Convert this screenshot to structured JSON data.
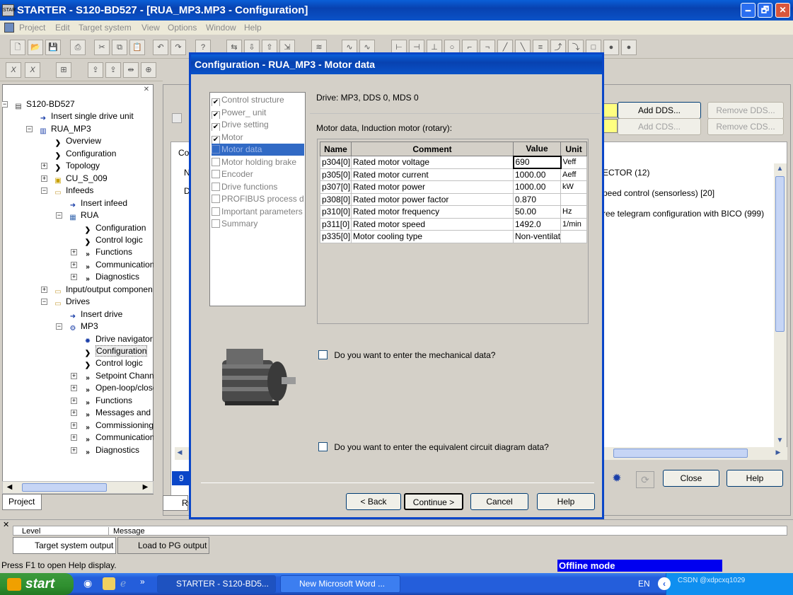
{
  "app": {
    "title": "STARTER - S120-BD527 - [RUA_MP3.MP3 - Configuration]",
    "icon_label": "STAR",
    "minimize": "🗕",
    "restore": "🗗",
    "close": "✕"
  },
  "menu": {
    "items": [
      "Project",
      "Edit",
      "Target system",
      "View",
      "Options",
      "Window",
      "Help"
    ]
  },
  "tree": {
    "items": [
      {
        "label": "S120-BD527",
        "icon": "project-icon"
      },
      {
        "label": "Insert single drive unit",
        "icon": "insert-icon"
      },
      {
        "label": "RUA_MP3",
        "icon": "drive-unit-icon"
      },
      {
        "label": "Overview",
        "icon": "chevron-right-icon"
      },
      {
        "label": "Configuration",
        "icon": "chevron-right-icon"
      },
      {
        "label": "Topology",
        "icon": "chevron-right-icon"
      },
      {
        "label": "CU_S_009",
        "icon": "cu-icon"
      },
      {
        "label": "Infeeds",
        "icon": "folder-icon"
      },
      {
        "label": "Insert infeed",
        "icon": "insert-icon"
      },
      {
        "label": "RUA",
        "icon": "lm-icon"
      },
      {
        "label": "Configuration",
        "icon": "chevron-right-icon"
      },
      {
        "label": "Control logic",
        "icon": "chevron-right-icon"
      },
      {
        "label": "Functions",
        "icon": "double-chevron-icon"
      },
      {
        "label": "Communication",
        "icon": "double-chevron-icon"
      },
      {
        "label": "Diagnostics",
        "icon": "double-chevron-icon"
      },
      {
        "label": "Input/output componen",
        "icon": "folder-icon"
      },
      {
        "label": "Drives",
        "icon": "folder-icon"
      },
      {
        "label": "Insert drive",
        "icon": "insert-icon"
      },
      {
        "label": "MP3",
        "icon": "motor-icon"
      },
      {
        "label": "Drive navigator",
        "icon": "gear-icon"
      },
      {
        "label": "Configuration",
        "icon": "chevron-right-icon"
      },
      {
        "label": "Control logic",
        "icon": "chevron-right-icon"
      },
      {
        "label": "Setpoint Channe",
        "icon": "double-chevron-icon"
      },
      {
        "label": "Open-loop/close",
        "icon": "double-chevron-icon"
      },
      {
        "label": "Functions",
        "icon": "double-chevron-icon"
      },
      {
        "label": "Messages and m",
        "icon": "double-chevron-icon"
      },
      {
        "label": "Commissioning",
        "icon": "double-chevron-icon"
      },
      {
        "label": "Communication",
        "icon": "double-chevron-icon"
      },
      {
        "label": "Diagnostics",
        "icon": "double-chevron-icon"
      }
    ],
    "tab_project": "Project"
  },
  "background": {
    "add_dds": "Add DDS...",
    "remove_dds": "Remove DDS...",
    "add_cds": "Add CDS...",
    "remove_cds": "Remove CDS...",
    "line1": "ECTOR (12)",
    "line2": "peed control (sensorless) [20]",
    "line3": "ree telegram configuration with BICO (999)",
    "tab_co": "Co",
    "label_n": "N",
    "label_d": "D",
    "close": "Close",
    "help": "Help",
    "nine": "9",
    "tab_r": "R"
  },
  "dialog": {
    "title": "Configuration - RUA_MP3 - Motor data",
    "drive_info": "Drive: MP3, DDS 0, MDS 0",
    "motor_info": "Motor data, Induction motor (rotary):",
    "nav": [
      {
        "label": "Control structure",
        "checked": true
      },
      {
        "label": "Power_ unit",
        "checked": true
      },
      {
        "label": "Drive setting",
        "checked": true
      },
      {
        "label": "Motor",
        "checked": true
      },
      {
        "label": "Motor data",
        "checked": false,
        "selected": true
      },
      {
        "label": "Motor holding brake",
        "checked": false
      },
      {
        "label": "Encoder",
        "checked": false
      },
      {
        "label": "Drive functions",
        "checked": false
      },
      {
        "label": "PROFIBUS process da",
        "checked": false
      },
      {
        "label": "Important parameters",
        "checked": false
      },
      {
        "label": "Summary",
        "checked": false
      }
    ],
    "table": {
      "headers": [
        "Name",
        "Comment",
        "Value",
        "Unit"
      ],
      "rows": [
        [
          "p304[0]",
          "Rated motor voltage",
          "690",
          "Veff"
        ],
        [
          "p305[0]",
          "Rated motor current",
          "1000.00",
          "Aeff"
        ],
        [
          "p307[0]",
          "Rated motor power",
          "1000.00",
          "kW"
        ],
        [
          "p308[0]",
          "Rated motor power factor",
          "0.870",
          ""
        ],
        [
          "p310[0]",
          "Rated motor frequency",
          "50.00",
          "Hz"
        ],
        [
          "p311[0]",
          "Rated motor speed",
          "1492.0",
          "1/min"
        ],
        [
          "p335[0]",
          "Motor cooling type",
          "Non-ventilat",
          ""
        ]
      ]
    },
    "q_mechanical": "Do you want to enter the mechanical data?",
    "q_circuit": "Do you want to enter the equivalent circuit diagram data?",
    "back": "< Back",
    "continue": "Continue >",
    "cancel": "Cancel",
    "help": "Help"
  },
  "output": {
    "col_level": "Level",
    "col_message": "Message",
    "tab_target": "Target system output",
    "tab_load": "Load to PG output"
  },
  "status": {
    "help_text": "Press F1 to open Help display.",
    "mode": "Offline mode"
  },
  "taskbar": {
    "start": "start",
    "app1": "STARTER - S120-BD5...",
    "app2": "New Microsoft Word ...",
    "lang": "EN",
    "watermark": "CSDN @xdpcxq1029"
  }
}
